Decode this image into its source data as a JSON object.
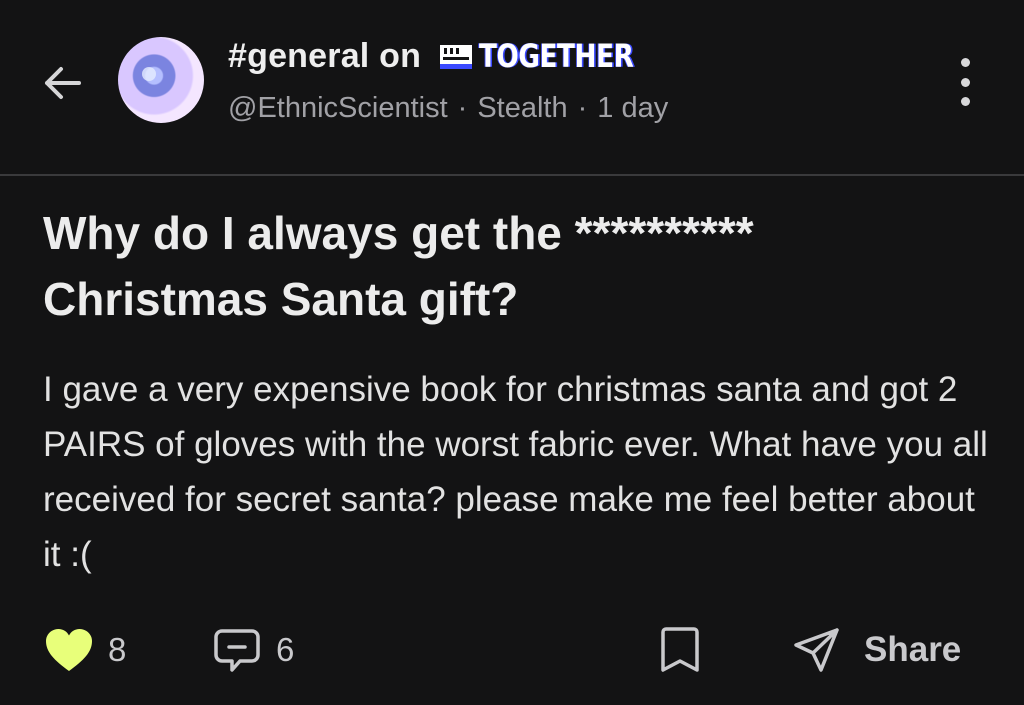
{
  "header": {
    "channel": "#general on",
    "brand": "TOGETHER",
    "author": "@EthnicScientist",
    "separator": "·",
    "company": "Stealth",
    "time": "1 day"
  },
  "post": {
    "title": "Why do I always get the ********** Christmas Santa gift?",
    "body": "I gave a very expensive book for christmas santa and got 2 PAIRS of gloves with the worst fabric ever. What have you all received for secret santa? please make me feel better about it :("
  },
  "actions": {
    "likes": "8",
    "comments": "6",
    "share_label": "Share"
  },
  "colors": {
    "background": "#131314",
    "like_heart": "#e8ff7a",
    "brand_accent": "#3b49ff"
  },
  "icons": {
    "back": "arrow-left-icon",
    "more": "more-vertical-icon",
    "like": "heart-icon",
    "comment": "comment-icon",
    "bookmark": "bookmark-icon",
    "share": "send-icon"
  }
}
